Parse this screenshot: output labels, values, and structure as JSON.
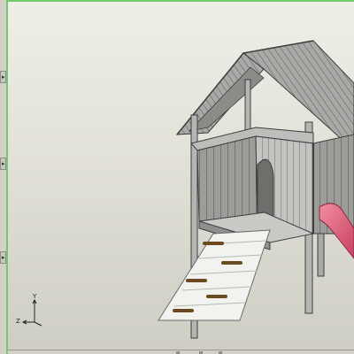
{
  "viewport": {
    "background_top": "#efefe8",
    "background_bottom": "#cfcec4",
    "model_colors": {
      "wood": "#b9b9b6",
      "wood_dark": "#7d7d7a",
      "wood_line": "#4a4a48",
      "slide": "#e0607a",
      "ramp": "#f2f2ee",
      "grip": "#6b4a22"
    }
  },
  "triad": {
    "x_label": "",
    "y_label": "Y",
    "z_label": "Z"
  },
  "panel": {
    "handles": [
      "expand-handle-top",
      "expand-handle-middle",
      "expand-handle-bottom"
    ],
    "handle_glyph": "▸"
  }
}
